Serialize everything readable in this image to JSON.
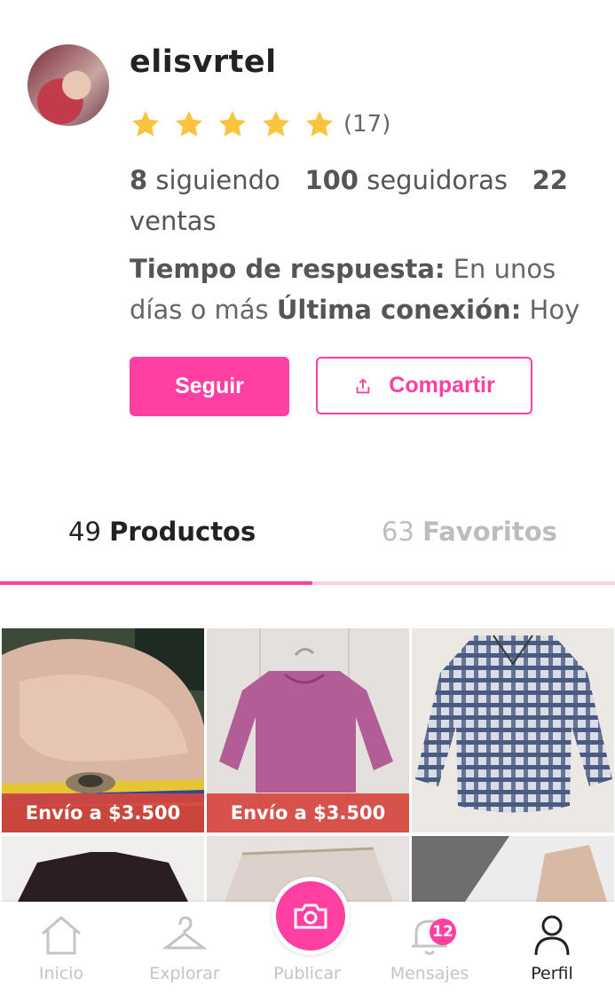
{
  "profile": {
    "username": "elisvrtel",
    "rating": {
      "stars": 5,
      "count": "(17)"
    },
    "stats": {
      "following_count": "8",
      "following_label": "siguiendo",
      "followers_count": "100",
      "followers_label": "seguidoras",
      "sales_count": "22",
      "sales_label": "ventas"
    },
    "response_label": "Tiempo de respuesta:",
    "response_value": "En unos días o más",
    "last_seen_label": "Última conexión:",
    "last_seen_value": "Hoy",
    "follow_button": "Seguir",
    "share_button": "Compartir"
  },
  "tabs": [
    {
      "count": "49",
      "label": "Productos",
      "active": true
    },
    {
      "count": "63",
      "label": "Favoritos",
      "active": false
    }
  ],
  "products": [
    {
      "shipping": "Envío a $3.500",
      "image": "ring-in-hand"
    },
    {
      "shipping": "Envío a $3.500",
      "image": "pink-sweater"
    },
    {
      "shipping": "",
      "image": "plaid-shirt"
    },
    {
      "shipping": "",
      "image": "dark-jacket"
    },
    {
      "shipping": "",
      "image": "beige-top"
    },
    {
      "shipping": "",
      "image": "tan-pants"
    }
  ],
  "nav": {
    "items": [
      {
        "label": "Inicio",
        "icon": "home-icon"
      },
      {
        "label": "Explorar",
        "icon": "hanger-icon"
      },
      {
        "label": "Publicar",
        "icon": "camera-icon"
      },
      {
        "label": "Mensajes",
        "icon": "bell-icon",
        "badge": "12"
      },
      {
        "label": "Perfil",
        "icon": "user-icon",
        "active": true
      }
    ]
  },
  "colors": {
    "accent": "#ff3fa2",
    "star": "#fcc43e",
    "shipping_banner": "#d6453e"
  }
}
